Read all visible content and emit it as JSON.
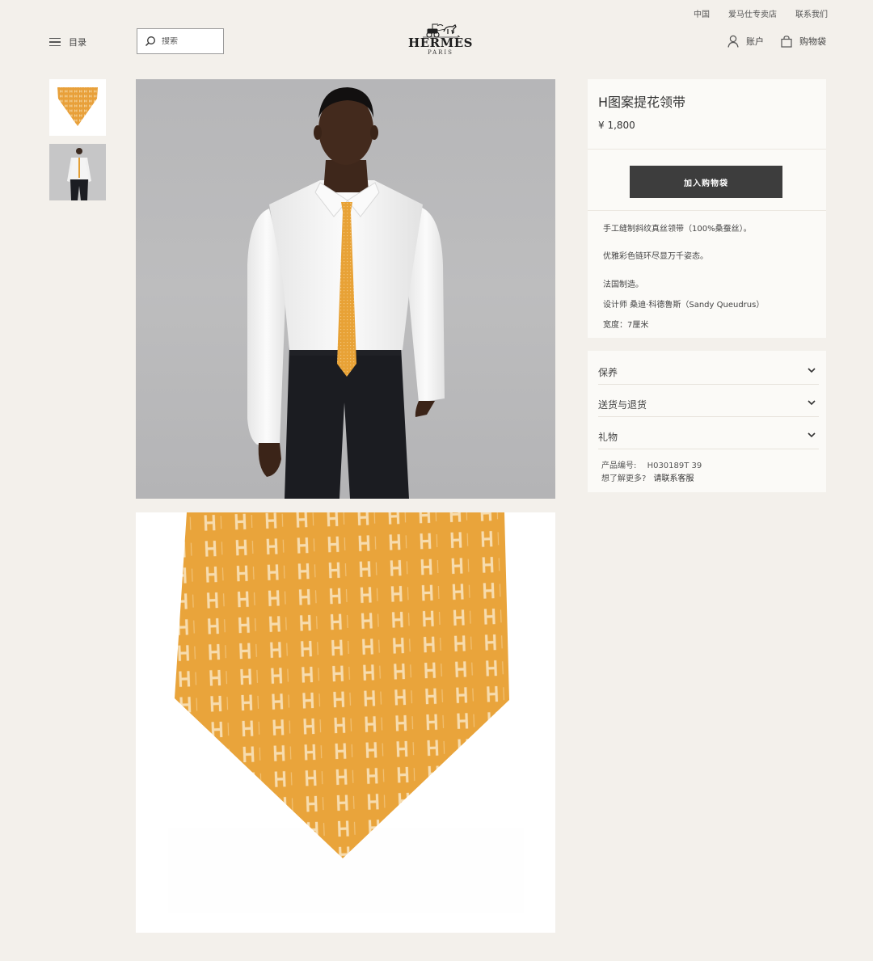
{
  "header": {
    "util_links": [
      "中国",
      "爱马仕专卖店",
      "联系我们"
    ],
    "menu_label": "目录",
    "search_placeholder": "搜索",
    "logo_text": "HERMÈS",
    "logo_sub": "PARIS",
    "account_label": "账户",
    "bag_label": "购物袋"
  },
  "product": {
    "title": "H图案提花领带",
    "price": "¥ 1,800",
    "add_to_bag": "加入购物袋",
    "description": [
      "手工缝制斜纹真丝领带（100%桑蚕丝）。",
      "优雅彩色链环尽显万千姿态。",
      "法国制造。",
      "设计师 桑迪·科德鲁斯（Sandy Queudrus）",
      "宽度：7厘米"
    ],
    "accordion": [
      "保养",
      "送货与退货",
      "礼物"
    ],
    "sku_label": "产品编号:",
    "sku_value": "H030189T 39",
    "more_label": "想了解更多?",
    "contact_link": "请联系客服"
  },
  "colors": {
    "background": "#f3f0eb",
    "tie": "#e9a43b",
    "button": "#3d3d3d",
    "card": "#fbfaf7"
  }
}
